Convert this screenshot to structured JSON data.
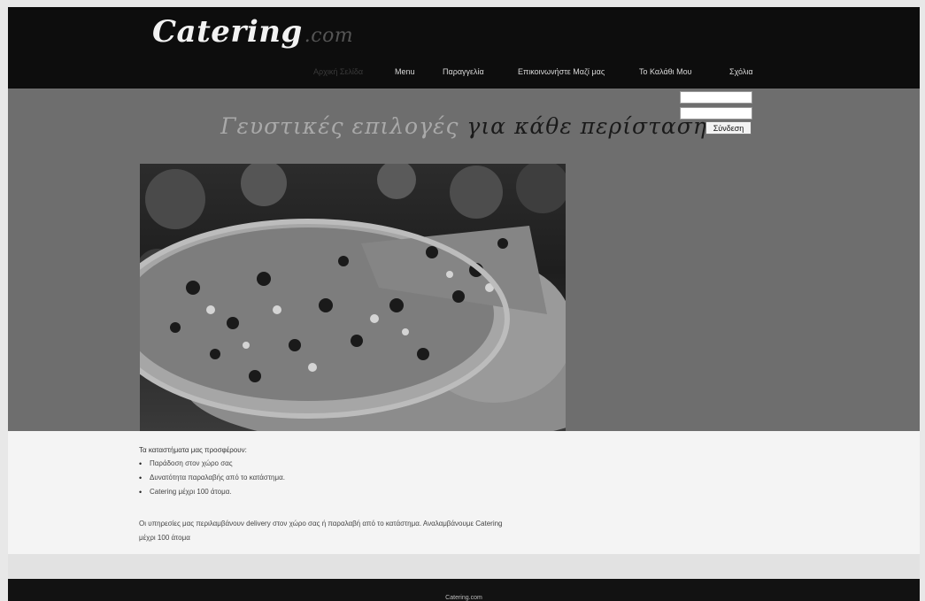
{
  "header": {
    "logo": "Catering",
    "logo_suffix": ".com",
    "nav": [
      {
        "label": "Αρχική Σελίδα"
      },
      {
        "label": "Menu"
      },
      {
        "label": "Παραγγελία"
      },
      {
        "label": "Επικοινωνήστε Μαζί μας"
      },
      {
        "label": "Το Καλάθι Μου"
      },
      {
        "label": "Σχόλια"
      }
    ]
  },
  "hero": {
    "title_part1": "Γευστικές επιλογές",
    "title_part2": "για κάθε περίσταση"
  },
  "login": {
    "submit_label": "Σύνδεση"
  },
  "content": {
    "lead": "Τα καταστήματα μας προσφέρουν:",
    "bullets": [
      "Παράδοση στον χώρο σας",
      "Δυνατότητα παραλαβής από το κατάστημα.",
      "Catering μέχρι 100 άτομα."
    ],
    "note_line1": "Οι υπηρεσίες μας περιλαμβάνουν delivery στον χώρο σας ή παραλαβή από το κατάστημα. Αναλαμβάνουμε Catering",
    "note_line2": "μέχρι 100 άτομα"
  },
  "footer": {
    "text": "Catering.com"
  }
}
